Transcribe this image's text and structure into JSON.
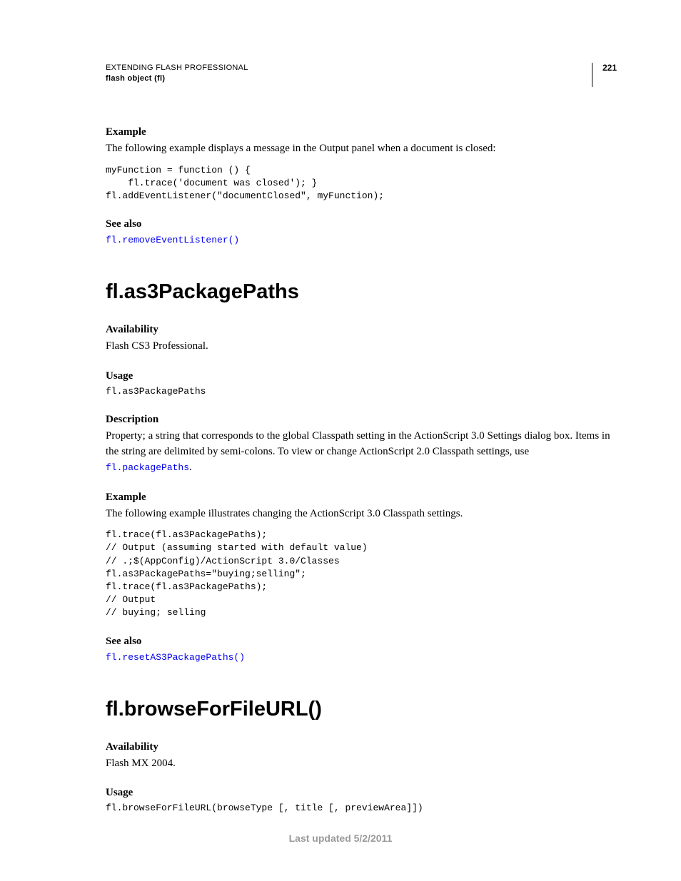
{
  "header": {
    "title": "EXTENDING FLASH PROFESSIONAL",
    "subtitle": "flash object (fl)",
    "page": "221"
  },
  "sec1": {
    "h_example": "Example",
    "example_text": "The following example displays a message in the Output panel when a document is closed:",
    "code1": "myFunction = function () {\n    fl.trace('document was closed'); }\nfl.addEventListener(\"documentClosed\", myFunction);",
    "h_seealso": "See also",
    "seealso_link": "fl.removeEventListener()"
  },
  "sec2": {
    "title": "fl.as3PackagePaths",
    "h_avail": "Availability",
    "avail_text": "Flash CS3 Professional.",
    "h_usage": "Usage",
    "usage_code": "fl.as3PackagePaths",
    "h_desc": "Description",
    "desc_text_a": "Property; a string that corresponds to the global Classpath setting in the ActionScript 3.0 Settings dialog box. Items in the string are delimited by semi-colons. To view or change ActionScript 2.0 Classpath settings, use ",
    "desc_link": "fl.packagePaths",
    "desc_text_b": ".",
    "h_example": "Example",
    "example_text": "The following example illustrates changing the ActionScript 3.0 Classpath settings.",
    "code2": "fl.trace(fl.as3PackagePaths);\n// Output (assuming started with default value)\n// .;$(AppConfig)/ActionScript 3.0/Classes\nfl.as3PackagePaths=\"buying;selling\";\nfl.trace(fl.as3PackagePaths);\n// Output\n// buying; selling",
    "h_seealso": "See also",
    "seealso_link": "fl.resetAS3PackagePaths()"
  },
  "sec3": {
    "title": "fl.browseForFileURL()",
    "h_avail": "Availability",
    "avail_text": "Flash MX 2004.",
    "h_usage": "Usage",
    "usage_code": "fl.browseForFileURL(browseType [, title [, previewArea]])"
  },
  "footer": "Last updated 5/2/2011"
}
